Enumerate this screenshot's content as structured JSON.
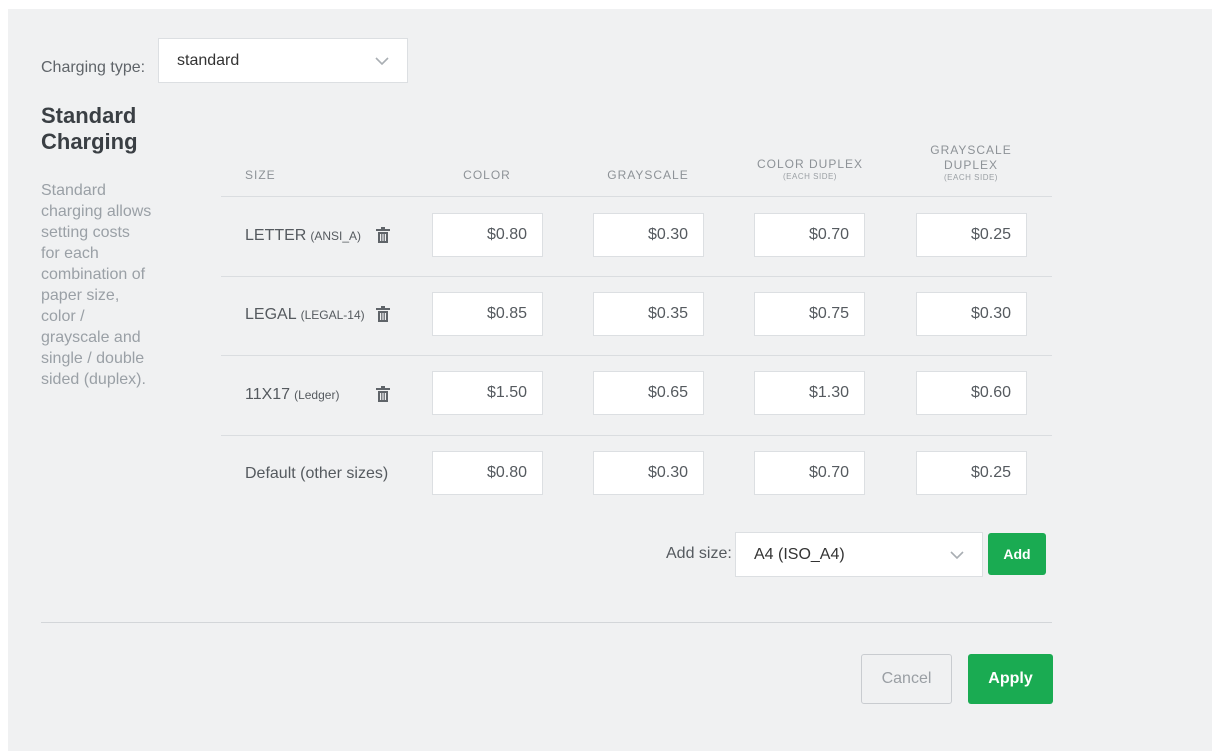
{
  "charging_type": {
    "label": "Charging type:",
    "value": "standard"
  },
  "section": {
    "title": "Standard Charging",
    "description": "Standard charging allows setting costs for each combination of paper size, color / grayscale and single / double sided (duplex)."
  },
  "table": {
    "headers": {
      "size": "SIZE",
      "color": "COLOR",
      "grayscale": "GRAYSCALE",
      "color_duplex": "COLOR DUPLEX",
      "color_duplex_note": "(EACH SIDE)",
      "grayscale_duplex_1": "GRAYSCALE",
      "grayscale_duplex_2": "DUPLEX",
      "grayscale_duplex_note": "(EACH SIDE)"
    },
    "rows": [
      {
        "name": "LETTER",
        "code": "(ANSI_A)",
        "deletable": true,
        "color": "$0.80",
        "grayscale": "$0.30",
        "color_duplex": "$0.70",
        "grayscale_duplex": "$0.25"
      },
      {
        "name": "LEGAL",
        "code": "(LEGAL-14)",
        "deletable": true,
        "color": "$0.85",
        "grayscale": "$0.35",
        "color_duplex": "$0.75",
        "grayscale_duplex": "$0.30"
      },
      {
        "name": "11X17",
        "code": "(Ledger)",
        "deletable": true,
        "color": "$1.50",
        "grayscale": "$0.65",
        "color_duplex": "$1.30",
        "grayscale_duplex": "$0.60"
      },
      {
        "name": "Default (other sizes)",
        "code": "",
        "deletable": false,
        "color": "$0.80",
        "grayscale": "$0.30",
        "color_duplex": "$0.70",
        "grayscale_duplex": "$0.25"
      }
    ]
  },
  "add_size": {
    "label": "Add size:",
    "value": "A4 (ISO_A4)",
    "button": "Add"
  },
  "actions": {
    "cancel": "Cancel",
    "apply": "Apply"
  },
  "icons": {
    "trash": "trash-icon",
    "chevron": "chevron-down-icon"
  },
  "colors": {
    "accent": "#1aab52",
    "panel_bg": "#f0f1f2"
  }
}
